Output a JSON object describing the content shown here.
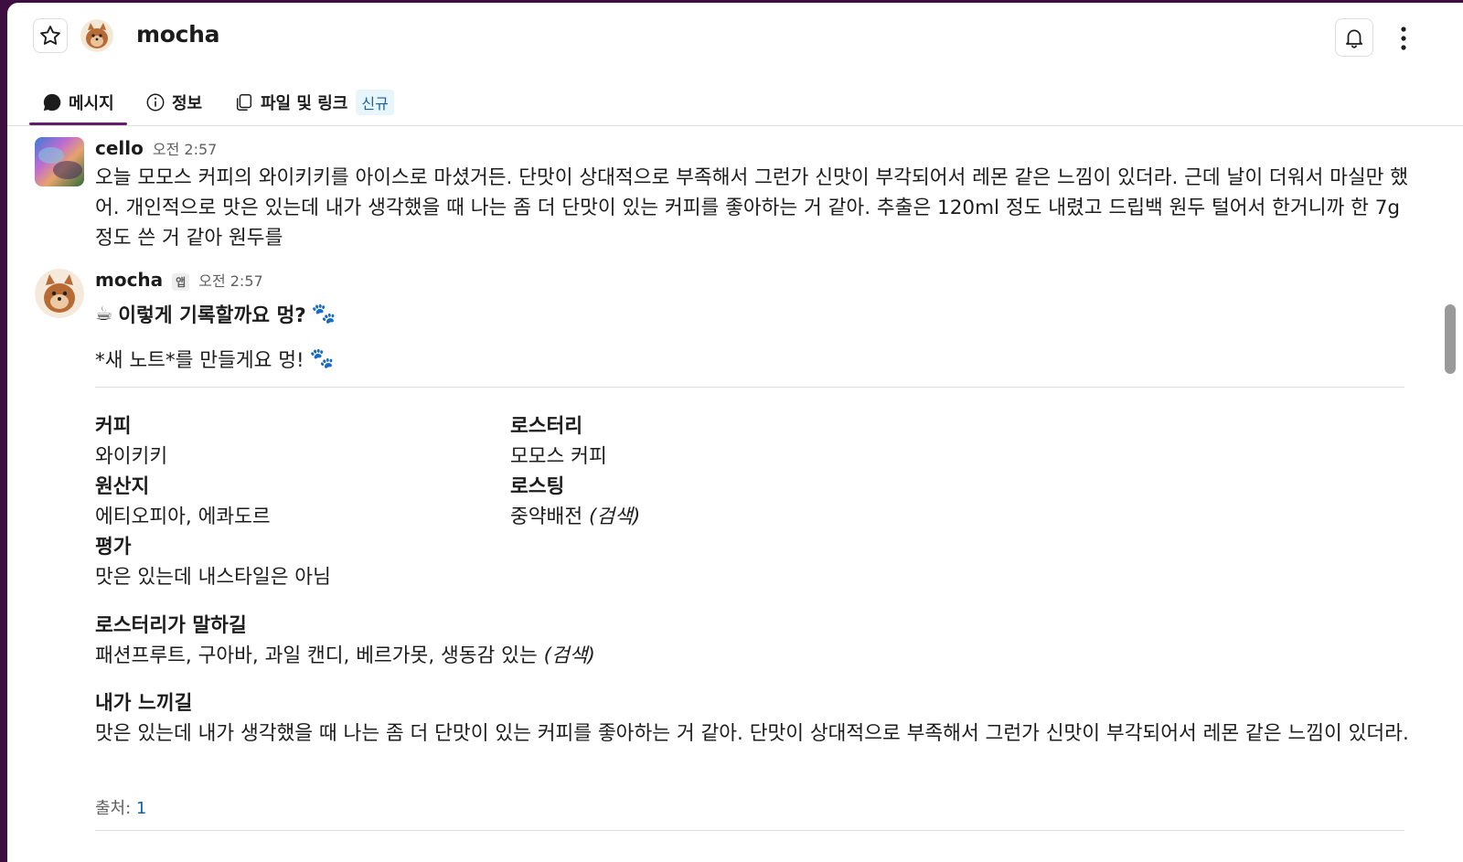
{
  "header": {
    "channel_name": "mocha",
    "star_icon": "star-outline-icon",
    "bell_icon": "bell-icon",
    "more_icon": "vertical-ellipsis-icon"
  },
  "tabs": [
    {
      "label": "메시지",
      "icon": "message-bubble-icon",
      "active": true
    },
    {
      "label": "정보",
      "icon": "info-icon",
      "active": false
    },
    {
      "label": "파일 및 링크",
      "icon": "files-icon",
      "active": false,
      "badge": "신규"
    }
  ],
  "messages": [
    {
      "sender": "cello",
      "time": "오전 2:57",
      "text": "오늘 모모스 커피의 와이키키를 아이스로 마셨거든. 단맛이 상대적으로 부족해서 그런가 신맛이 부각되어서 레몬 같은 느낌이 있더라. 근데 날이 더워서 마실만 했어. 개인적으로 맛은 있는데 내가 생각했을 때 나는 좀 더 단맛이 있는 커피를 좋아하는 거 같아. 추출은 120ml 정도 내렸고 드립백 원두 털어서 한거니까 한 7g 정도 쓴 거 같아 원두를"
    },
    {
      "sender": "mocha",
      "app_badge": "앱",
      "time": "오전 2:57",
      "title": "이렇게 기록할까요 멍?",
      "title_emoji": "☕",
      "subtitle": "*새 노트*를 만들게요 멍!",
      "paw_emoji": "🐾",
      "fields": {
        "coffee_label": "커피",
        "coffee_value": "와이키키",
        "roastery_label": "로스터리",
        "roastery_value": "모모스 커피",
        "origin_label": "원산지",
        "origin_value": "에티오피아, 에콰도르",
        "roasting_label": "로스팅",
        "roasting_value": "중약배전",
        "roasting_note": "(검색)",
        "rating_label": "평가",
        "rating_value": "맛은 있는데 내스타일은 아님",
        "roaster_says_label": "로스터리가 말하길",
        "roaster_says_value": "패션프루트, 구아바, 과일 캔디, 베르가못, 생동감 있는",
        "roaster_says_note": "(검색)",
        "i_felt_label": "내가 느끼길",
        "i_felt_value": "맛은 있는데 내가 생각했을 때 나는 좀 더 단맛이 있는 커피를 좋아하는 거 같아. 단맛이 상대적으로 부족해서 그런가 신맛이 부각되어서 레몬 같은 느낌이 있더라."
      },
      "source_label": "출처:",
      "source_link": "1"
    }
  ]
}
